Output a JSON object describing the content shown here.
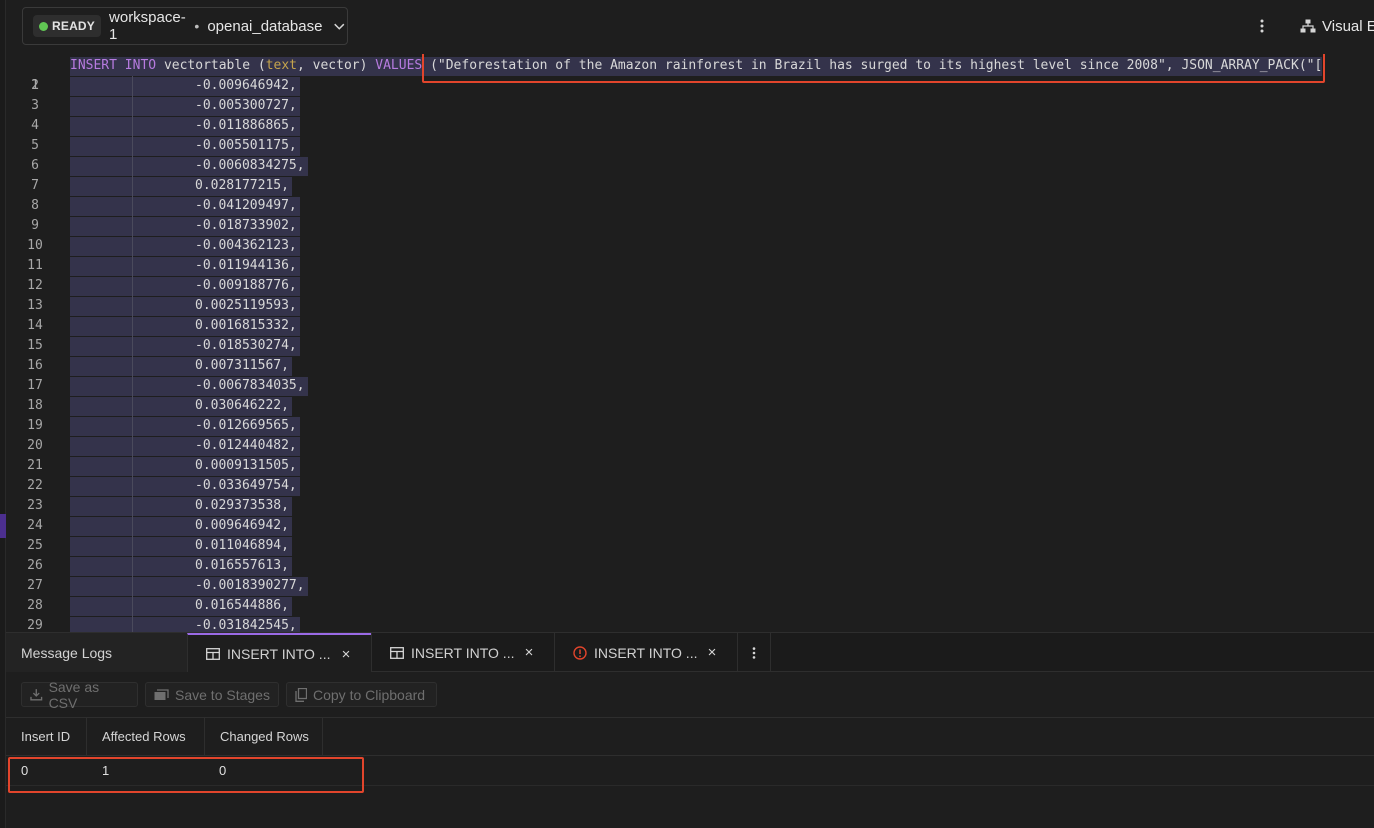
{
  "header": {
    "status": "READY",
    "workspace": "workspace-1",
    "separator": "•",
    "database": "openai_database",
    "visual_explain_label": "Visual Ex"
  },
  "editor": {
    "line1": {
      "kw_insert": "INSERT",
      "kw_into": "INTO",
      "table": "vectortable",
      "cols_open": "(",
      "col_text": "text",
      "cols_rest": ", vector)",
      "kw_values": "VALUES",
      "values_text": "(\"Deforestation of the Amazon rainforest in Brazil has surged to its highest level since 2008\", JSON_ARRAY_PACK(\"["
    },
    "lines": [
      {
        "n": "1"
      },
      {
        "n": "2",
        "v": "-0.009646942,"
      },
      {
        "n": "3",
        "v": "-0.005300727,"
      },
      {
        "n": "4",
        "v": "-0.011886865,"
      },
      {
        "n": "5",
        "v": "-0.005501175,"
      },
      {
        "n": "6",
        "v": "-0.0060834275,"
      },
      {
        "n": "7",
        "v": "0.028177215,"
      },
      {
        "n": "8",
        "v": "-0.041209497,"
      },
      {
        "n": "9",
        "v": "-0.018733902,"
      },
      {
        "n": "10",
        "v": "-0.004362123,"
      },
      {
        "n": "11",
        "v": "-0.011944136,"
      },
      {
        "n": "12",
        "v": "-0.009188776,"
      },
      {
        "n": "13",
        "v": "0.0025119593,"
      },
      {
        "n": "14",
        "v": "0.0016815332,"
      },
      {
        "n": "15",
        "v": "-0.018530274,"
      },
      {
        "n": "16",
        "v": "0.007311567,"
      },
      {
        "n": "17",
        "v": "-0.0067834035,"
      },
      {
        "n": "18",
        "v": "0.030646222,"
      },
      {
        "n": "19",
        "v": "-0.012669565,"
      },
      {
        "n": "20",
        "v": "-0.012440482,"
      },
      {
        "n": "21",
        "v": "0.0009131505,"
      },
      {
        "n": "22",
        "v": "-0.033649754,"
      },
      {
        "n": "23",
        "v": "0.029373538,"
      },
      {
        "n": "24",
        "v": "0.009646942,"
      },
      {
        "n": "25",
        "v": "0.011046894,"
      },
      {
        "n": "26",
        "v": "0.016557613,"
      },
      {
        "n": "27",
        "v": "-0.0018390277,"
      },
      {
        "n": "28",
        "v": "0.016544886,"
      },
      {
        "n": "29",
        "v": "-0.031842545,"
      }
    ]
  },
  "tabs": {
    "message_logs": "Message Logs",
    "tab1": "INSERT INTO ...",
    "tab2": "INSERT INTO ...",
    "tab3": "INSERT INTO ...",
    "close": "×"
  },
  "toolbar": {
    "save_csv": "Save as CSV",
    "save_stages": "Save to Stages",
    "copy_clipboard": "Copy to Clipboard"
  },
  "results": {
    "columns": [
      "Insert ID",
      "Affected Rows",
      "Changed Rows"
    ],
    "rows": [
      [
        "0",
        "1",
        "0"
      ]
    ]
  },
  "colors": {
    "status_ready": "#61c754",
    "keyword": "#b77be0",
    "function": "#c5a44d",
    "highlight_box": "#e2452c",
    "active_tab_accent": "#9a6ae6",
    "error_icon": "#e2452c"
  },
  "icons": {
    "chevron": "chevron-down-icon",
    "kebab": "kebab-menu-icon",
    "visual_explain": "hierarchy-icon",
    "table": "table-icon",
    "error": "error-circle-icon",
    "close": "close-icon",
    "download": "download-icon",
    "stages": "stages-icon",
    "copy": "copy-icon"
  }
}
